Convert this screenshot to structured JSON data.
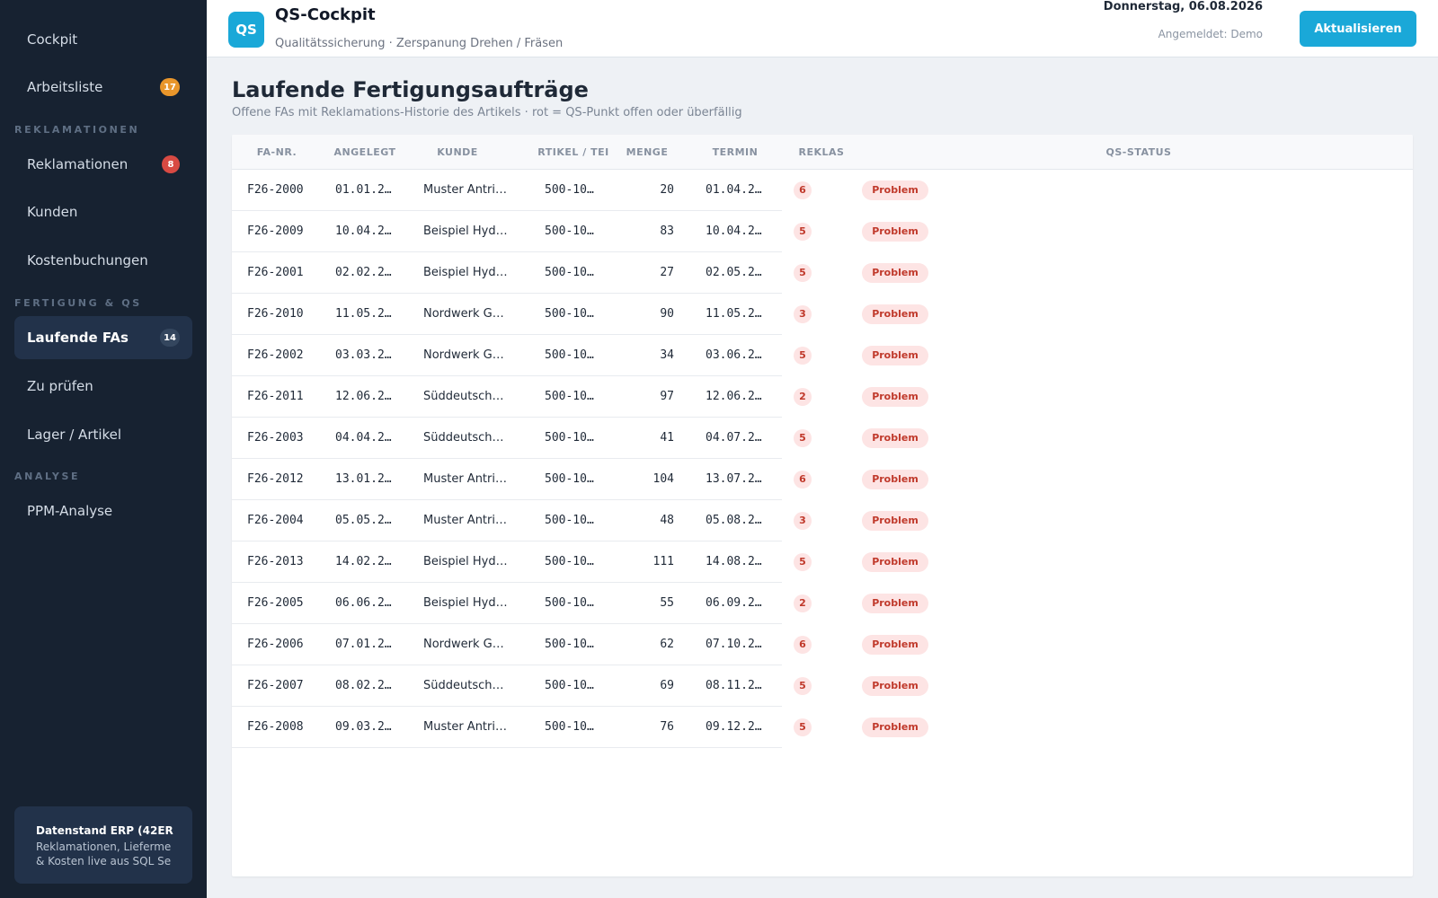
{
  "sidebar": {
    "items": [
      {
        "label": "Cockpit",
        "badge": null
      },
      {
        "label": "Arbeitsliste",
        "badge": "17",
        "badge_color": "#e9962b"
      },
      {
        "label": "Reklamationen",
        "badge": "8",
        "badge_color": "#d84a43"
      },
      {
        "label": "Kunden",
        "badge": null
      },
      {
        "label": "Kostenbuchungen",
        "badge": null
      },
      {
        "label": "Laufende FAs",
        "badge": "14",
        "active": true
      },
      {
        "label": "Zu prüfen",
        "badge": null
      },
      {
        "label": "Lager / Artikel",
        "badge": null
      },
      {
        "label": "PPM-Analyse",
        "badge": null
      }
    ],
    "sections": [
      "REKLAMATIONEN",
      "FERTIGUNG & QS",
      "ANALYSE"
    ],
    "info": {
      "title": "Datenstand ERP (42ER",
      "line1": "Reklamationen, Lieferme",
      "line2": "& Kosten live aus SQL Se"
    }
  },
  "header": {
    "logo": "QS",
    "title": "QS-Cockpit",
    "subtitle": "Qualitätssicherung · Zerspanung Drehen / Fräsen",
    "date": "Donnerstag, 06.08.2026",
    "user": "Angemeldet: Demo",
    "refresh_label": "Aktualisieren"
  },
  "main": {
    "title": "Laufende Fertigungsaufträge",
    "subtitle": "Offene FAs mit Reklamations-Historie des Artikels · rot = QS-Punkt offen oder überfällig",
    "columns": [
      "FA-NR.",
      "ANGELEGT",
      "KUNDE",
      "RTIKEL / TEI",
      "MENGE",
      "TERMIN",
      "REKLAS",
      "QS-STATUS"
    ],
    "rows": [
      {
        "fa": "F26-2000",
        "angelegt": "01.01.2…",
        "kunde": "Muster Antri…",
        "artikel": "500-10…",
        "menge": "20",
        "termin": "01.04.2…",
        "reklas": "6",
        "status": "Problem"
      },
      {
        "fa": "F26-2009",
        "angelegt": "10.04.2…",
        "kunde": "Beispiel Hyd…",
        "artikel": "500-10…",
        "menge": "83",
        "termin": "10.04.2…",
        "reklas": "5",
        "status": "Problem"
      },
      {
        "fa": "F26-2001",
        "angelegt": "02.02.2…",
        "kunde": "Beispiel Hyd…",
        "artikel": "500-10…",
        "menge": "27",
        "termin": "02.05.2…",
        "reklas": "5",
        "status": "Problem"
      },
      {
        "fa": "F26-2010",
        "angelegt": "11.05.2…",
        "kunde": "Nordwerk G…",
        "artikel": "500-10…",
        "menge": "90",
        "termin": "11.05.2…",
        "reklas": "3",
        "status": "Problem"
      },
      {
        "fa": "F26-2002",
        "angelegt": "03.03.2…",
        "kunde": "Nordwerk G…",
        "artikel": "500-10…",
        "menge": "34",
        "termin": "03.06.2…",
        "reklas": "5",
        "status": "Problem"
      },
      {
        "fa": "F26-2011",
        "angelegt": "12.06.2…",
        "kunde": "Süddeutsch…",
        "artikel": "500-10…",
        "menge": "97",
        "termin": "12.06.2…",
        "reklas": "2",
        "status": "Problem"
      },
      {
        "fa": "F26-2003",
        "angelegt": "04.04.2…",
        "kunde": "Süddeutsch…",
        "artikel": "500-10…",
        "menge": "41",
        "termin": "04.07.2…",
        "reklas": "5",
        "status": "Problem"
      },
      {
        "fa": "F26-2012",
        "angelegt": "13.01.2…",
        "kunde": "Muster Antri…",
        "artikel": "500-10…",
        "menge": "104",
        "termin": "13.07.2…",
        "reklas": "6",
        "status": "Problem"
      },
      {
        "fa": "F26-2004",
        "angelegt": "05.05.2…",
        "kunde": "Muster Antri…",
        "artikel": "500-10…",
        "menge": "48",
        "termin": "05.08.2…",
        "reklas": "3",
        "status": "Problem"
      },
      {
        "fa": "F26-2013",
        "angelegt": "14.02.2…",
        "kunde": "Beispiel Hyd…",
        "artikel": "500-10…",
        "menge": "111",
        "termin": "14.08.2…",
        "reklas": "5",
        "status": "Problem"
      },
      {
        "fa": "F26-2005",
        "angelegt": "06.06.2…",
        "kunde": "Beispiel Hyd…",
        "artikel": "500-10…",
        "menge": "55",
        "termin": "06.09.2…",
        "reklas": "2",
        "status": "Problem"
      },
      {
        "fa": "F26-2006",
        "angelegt": "07.01.2…",
        "kunde": "Nordwerk G…",
        "artikel": "500-10…",
        "menge": "62",
        "termin": "07.10.2…",
        "reklas": "6",
        "status": "Problem"
      },
      {
        "fa": "F26-2007",
        "angelegt": "08.02.2…",
        "kunde": "Süddeutsch…",
        "artikel": "500-10…",
        "menge": "69",
        "termin": "08.11.2…",
        "reklas": "5",
        "status": "Problem"
      },
      {
        "fa": "F26-2008",
        "angelegt": "09.03.2…",
        "kunde": "Muster Antri…",
        "artikel": "500-10…",
        "menge": "76",
        "termin": "09.12.2…",
        "reklas": "5",
        "status": "Problem"
      }
    ]
  },
  "colors": {
    "accent": "#1aa8d8",
    "sidebar_bg": "#172231",
    "problem_red": "#c0392b",
    "badge_orange": "#e9962b",
    "badge_red": "#d84a43"
  }
}
